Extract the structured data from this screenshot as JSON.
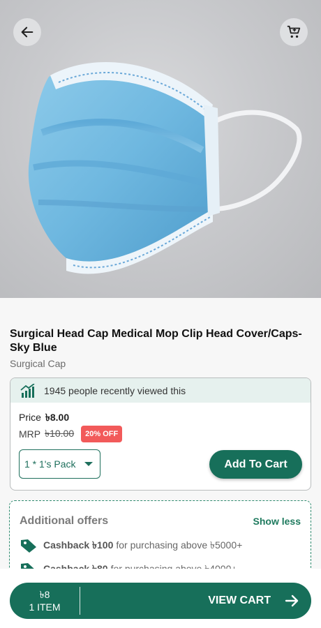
{
  "header": {
    "back_icon": "arrow-left-icon",
    "cart_icon": "cart-icon"
  },
  "product": {
    "title": "Surgical Head Cap Medical Mop Clip Head Cover/Caps-Sky Blue",
    "category": "Surgical Cap",
    "viewed_text": "1945 people recently viewed this",
    "price_label": "Price",
    "price_value": "৳8.00",
    "mrp_label": "MRP",
    "mrp_value": "৳10.00",
    "discount_badge": "20% OFF",
    "pack_option": "1 * 1's Pack",
    "add_to_cart_label": "Add To Cart"
  },
  "offers": {
    "heading": "Additional offers",
    "toggle_label": "Show less",
    "items": [
      {
        "bold": "Cashback ৳100",
        "text": "for purchasing above ৳5000+"
      },
      {
        "bold": "Cashback ৳80",
        "text": "for purchasing above ৳4000+"
      }
    ]
  },
  "cart_bar": {
    "amount": "৳8",
    "items": "1 ITEM",
    "action_label": "VIEW CART"
  },
  "colors": {
    "brand_green": "#176f5a",
    "badge_red": "#f25a5a",
    "viewed_bg": "#e6f1ee"
  }
}
